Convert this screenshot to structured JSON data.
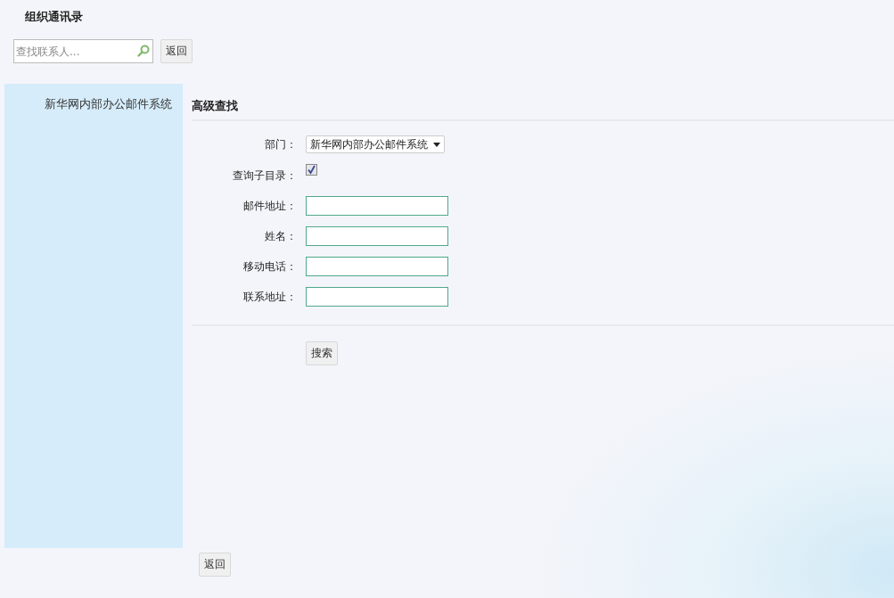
{
  "title": "组织通讯录",
  "search": {
    "placeholder": "查找联系人..."
  },
  "top_back_button": "返回",
  "sidebar": {
    "items": [
      {
        "label": "新华网内部办公邮件系统"
      }
    ]
  },
  "advanced_search": {
    "heading": "高级查找",
    "fields": [
      {
        "kind": "select",
        "label": "部门：",
        "value": "新华网内部办公邮件系统"
      },
      {
        "kind": "checkbox",
        "label": "查询子目录：",
        "checked": true
      },
      {
        "kind": "text",
        "label": "邮件地址："
      },
      {
        "kind": "text",
        "label": "姓名："
      },
      {
        "kind": "text",
        "label": "移动电话："
      },
      {
        "kind": "text",
        "label": "联系地址："
      }
    ],
    "search_button": "搜索"
  },
  "bottom_back_button": "返回"
}
